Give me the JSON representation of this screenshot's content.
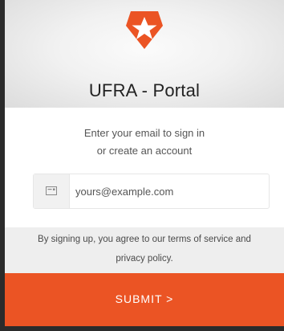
{
  "brand": {
    "accent": "#eb5424",
    "logo_icon": "auth0-star-shield-icon"
  },
  "header": {
    "title": "UFRA - Portal"
  },
  "prompt": {
    "line1": "Enter your email to sign in",
    "line2": "or create an account"
  },
  "email": {
    "icon": "envelope-icon",
    "placeholder": "yours@example.com",
    "value": ""
  },
  "terms": {
    "line1": "By signing up, you agree to our terms of service and",
    "line2": "privacy policy."
  },
  "submit": {
    "label": "SUBMIT >"
  }
}
